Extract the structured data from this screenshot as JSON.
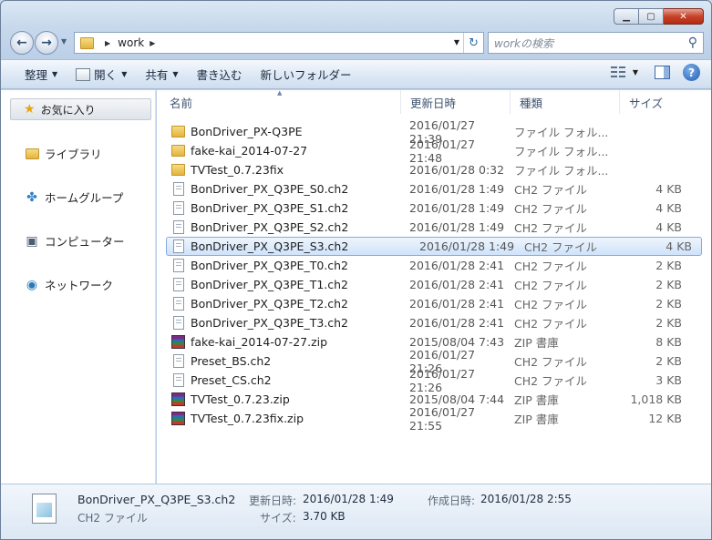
{
  "window": {
    "current_folder": "work"
  },
  "search": {
    "placeholder": "workの検索"
  },
  "toolbar": {
    "organize": "整理",
    "open": "開く",
    "share": "共有",
    "burn": "書き込む",
    "new_folder": "新しいフォルダー"
  },
  "nav": {
    "favorites": "お気に入り",
    "libraries": "ライブラリ",
    "homegroup": "ホームグループ",
    "computer": "コンピューター",
    "network": "ネットワーク"
  },
  "columns": {
    "name": "名前",
    "date": "更新日時",
    "type": "種類",
    "size": "サイズ"
  },
  "files": [
    {
      "name": "BonDriver_PX-Q3PE",
      "date": "2016/01/27 21:39",
      "type": "ファイル フォル...",
      "size": "",
      "icon": "folder"
    },
    {
      "name": "fake-kai_2014-07-27",
      "date": "2016/01/27 21:48",
      "type": "ファイル フォル...",
      "size": "",
      "icon": "folder"
    },
    {
      "name": "TVTest_0.7.23fix",
      "date": "2016/01/28 0:32",
      "type": "ファイル フォル...",
      "size": "",
      "icon": "folder"
    },
    {
      "name": "BonDriver_PX_Q3PE_S0.ch2",
      "date": "2016/01/28 1:49",
      "type": "CH2 ファイル",
      "size": "4 KB",
      "icon": "doc"
    },
    {
      "name": "BonDriver_PX_Q3PE_S1.ch2",
      "date": "2016/01/28 1:49",
      "type": "CH2 ファイル",
      "size": "4 KB",
      "icon": "doc"
    },
    {
      "name": "BonDriver_PX_Q3PE_S2.ch2",
      "date": "2016/01/28 1:49",
      "type": "CH2 ファイル",
      "size": "4 KB",
      "icon": "doc"
    },
    {
      "name": "BonDriver_PX_Q3PE_S3.ch2",
      "date": "2016/01/28 1:49",
      "type": "CH2 ファイル",
      "size": "4 KB",
      "icon": "doc",
      "selected": true
    },
    {
      "name": "BonDriver_PX_Q3PE_T0.ch2",
      "date": "2016/01/28 2:41",
      "type": "CH2 ファイル",
      "size": "2 KB",
      "icon": "doc"
    },
    {
      "name": "BonDriver_PX_Q3PE_T1.ch2",
      "date": "2016/01/28 2:41",
      "type": "CH2 ファイル",
      "size": "2 KB",
      "icon": "doc"
    },
    {
      "name": "BonDriver_PX_Q3PE_T2.ch2",
      "date": "2016/01/28 2:41",
      "type": "CH2 ファイル",
      "size": "2 KB",
      "icon": "doc"
    },
    {
      "name": "BonDriver_PX_Q3PE_T3.ch2",
      "date": "2016/01/28 2:41",
      "type": "CH2 ファイル",
      "size": "2 KB",
      "icon": "doc"
    },
    {
      "name": "fake-kai_2014-07-27.zip",
      "date": "2015/08/04 7:43",
      "type": "ZIP 書庫",
      "size": "8 KB",
      "icon": "zip"
    },
    {
      "name": "Preset_BS.ch2",
      "date": "2016/01/27 21:26",
      "type": "CH2 ファイル",
      "size": "2 KB",
      "icon": "doc"
    },
    {
      "name": "Preset_CS.ch2",
      "date": "2016/01/27 21:26",
      "type": "CH2 ファイル",
      "size": "3 KB",
      "icon": "doc"
    },
    {
      "name": "TVTest_0.7.23.zip",
      "date": "2015/08/04 7:44",
      "type": "ZIP 書庫",
      "size": "1,018 KB",
      "icon": "zip"
    },
    {
      "name": "TVTest_0.7.23fix.zip",
      "date": "2016/01/27 21:55",
      "type": "ZIP 書庫",
      "size": "12 KB",
      "icon": "zip"
    }
  ],
  "details": {
    "name": "BonDriver_PX_Q3PE_S3.ch2",
    "type": "CH2 ファイル",
    "modified_label": "更新日時:",
    "modified_value": "2016/01/28 1:49",
    "created_label": "作成日時:",
    "created_value": "2016/01/28 2:55",
    "size_label": "サイズ:",
    "size_value": "3.70 KB"
  }
}
